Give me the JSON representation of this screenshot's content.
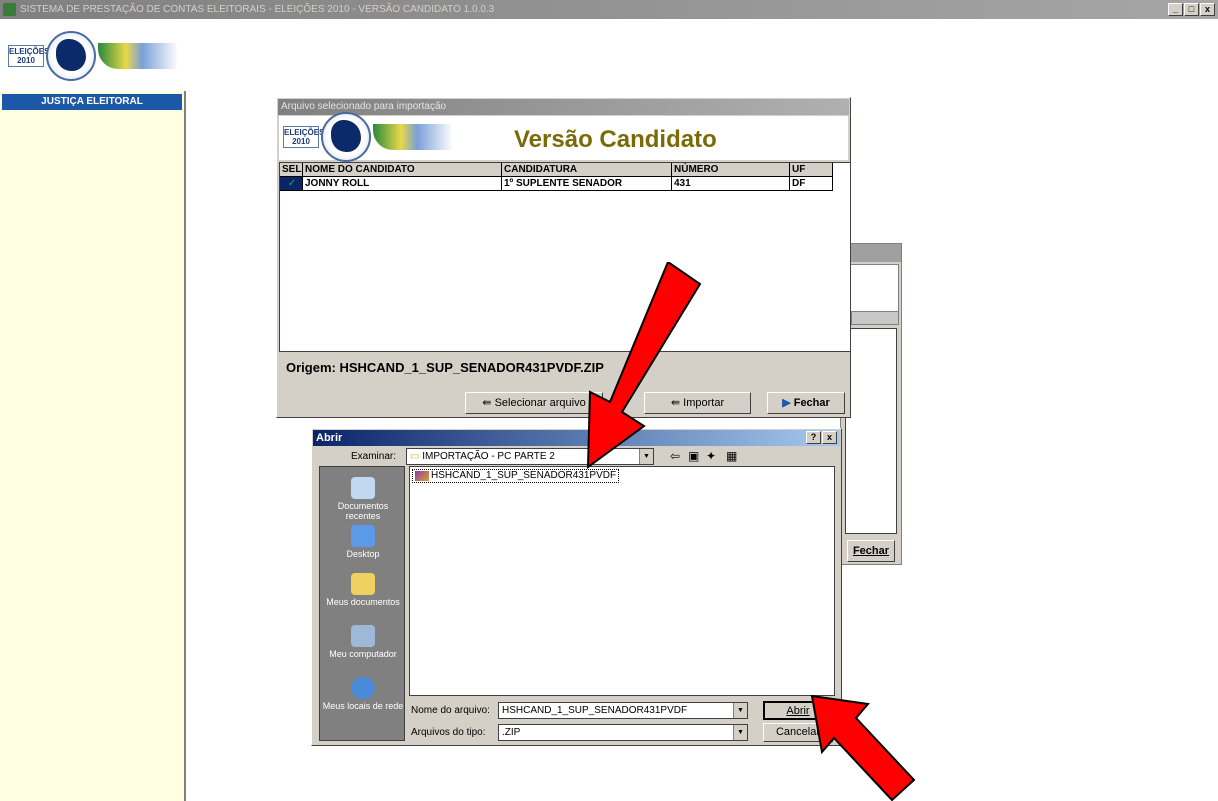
{
  "app": {
    "title": "SISTEMA DE PRESTAÇÃO DE CONTAS ELEITORAIS - ELEIÇÕES 2010 -  VERSÃO CANDIDATO 1.0.0.3",
    "window_buttons": {
      "minimize": "_",
      "maximize": "□",
      "close": "x"
    }
  },
  "sidebar": {
    "logo_text_line1": "ELEIÇÕES",
    "logo_text_line2": "2010",
    "header": "JUSTIÇA ELEITORAL"
  },
  "background_dialog": {
    "close_label": "Fechar"
  },
  "import_dialog": {
    "title": "Arquivo selecionado para importação",
    "logo_text_line1": "ELEIÇÕES",
    "logo_text_line2": "2010",
    "heading": "Versão Candidato",
    "columns": [
      "SEL.",
      "NOME DO CANDIDATO",
      "CANDIDATURA",
      "NÚMERO",
      "UF"
    ],
    "rows": [
      {
        "sel": "✓",
        "nome": "JONNY ROLL",
        "candidatura": "1º SUPLENTE SENADOR",
        "numero": "431",
        "uf": "DF"
      }
    ],
    "origem_label": "Origem: HSHCAND_1_SUP_SENADOR431PVDF.ZIP",
    "buttons": {
      "select": "Selecionar arquivo",
      "import": "Importar",
      "close": "Fechar"
    }
  },
  "open_dialog": {
    "title": "Abrir",
    "help_button": "?",
    "close_button": "x",
    "look_in_label": "Examinar:",
    "look_in_value": "IMPORTAÇÃO - PC PARTE 2",
    "places": [
      {
        "label": "Documentos recentes",
        "icon": "recent-documents-icon"
      },
      {
        "label": "Desktop",
        "icon": "desktop-icon"
      },
      {
        "label": "Meus documentos",
        "icon": "my-documents-icon"
      },
      {
        "label": "Meu computador",
        "icon": "my-computer-icon"
      },
      {
        "label": "Meus locais de rede",
        "icon": "network-places-icon"
      }
    ],
    "files": [
      "HSHCAND_1_SUP_SENADOR431PVDF"
    ],
    "filename_label": "Nome do arquivo:",
    "filename_value": "HSHCAND_1_SUP_SENADOR431PVDF",
    "filetype_label": "Arquivos do tipo:",
    "filetype_value": ".ZIP",
    "open_button": "Abrir",
    "cancel_button": "Cancelar"
  },
  "colors": {
    "heading": "#7a6a08",
    "sidebar_bg": "#ffffe1",
    "sidebar_header_bg": "#1c58a8",
    "arrow": "#ff0000"
  }
}
